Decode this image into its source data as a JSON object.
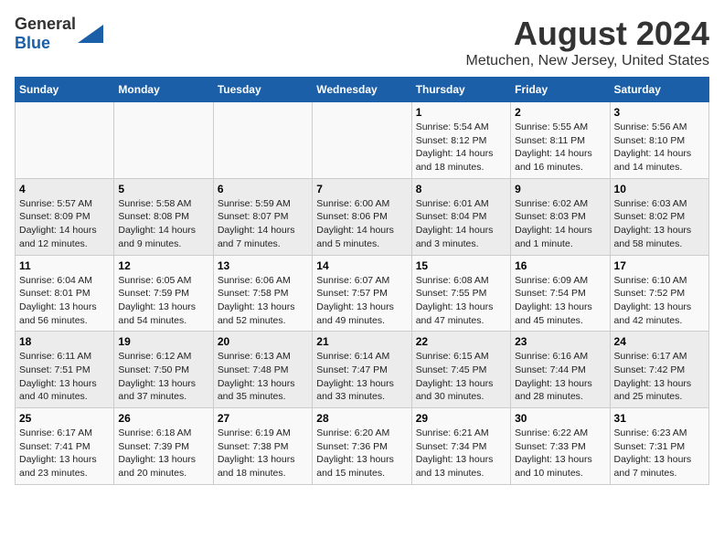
{
  "header": {
    "logo_general": "General",
    "logo_blue": "Blue",
    "month_title": "August 2024",
    "location": "Metuchen, New Jersey, United States"
  },
  "days_of_week": [
    "Sunday",
    "Monday",
    "Tuesday",
    "Wednesday",
    "Thursday",
    "Friday",
    "Saturday"
  ],
  "weeks": [
    [
      {
        "day": "",
        "info": ""
      },
      {
        "day": "",
        "info": ""
      },
      {
        "day": "",
        "info": ""
      },
      {
        "day": "",
        "info": ""
      },
      {
        "day": "1",
        "info": "Sunrise: 5:54 AM\nSunset: 8:12 PM\nDaylight: 14 hours\nand 18 minutes."
      },
      {
        "day": "2",
        "info": "Sunrise: 5:55 AM\nSunset: 8:11 PM\nDaylight: 14 hours\nand 16 minutes."
      },
      {
        "day": "3",
        "info": "Sunrise: 5:56 AM\nSunset: 8:10 PM\nDaylight: 14 hours\nand 14 minutes."
      }
    ],
    [
      {
        "day": "4",
        "info": "Sunrise: 5:57 AM\nSunset: 8:09 PM\nDaylight: 14 hours\nand 12 minutes."
      },
      {
        "day": "5",
        "info": "Sunrise: 5:58 AM\nSunset: 8:08 PM\nDaylight: 14 hours\nand 9 minutes."
      },
      {
        "day": "6",
        "info": "Sunrise: 5:59 AM\nSunset: 8:07 PM\nDaylight: 14 hours\nand 7 minutes."
      },
      {
        "day": "7",
        "info": "Sunrise: 6:00 AM\nSunset: 8:06 PM\nDaylight: 14 hours\nand 5 minutes."
      },
      {
        "day": "8",
        "info": "Sunrise: 6:01 AM\nSunset: 8:04 PM\nDaylight: 14 hours\nand 3 minutes."
      },
      {
        "day": "9",
        "info": "Sunrise: 6:02 AM\nSunset: 8:03 PM\nDaylight: 14 hours\nand 1 minute."
      },
      {
        "day": "10",
        "info": "Sunrise: 6:03 AM\nSunset: 8:02 PM\nDaylight: 13 hours\nand 58 minutes."
      }
    ],
    [
      {
        "day": "11",
        "info": "Sunrise: 6:04 AM\nSunset: 8:01 PM\nDaylight: 13 hours\nand 56 minutes."
      },
      {
        "day": "12",
        "info": "Sunrise: 6:05 AM\nSunset: 7:59 PM\nDaylight: 13 hours\nand 54 minutes."
      },
      {
        "day": "13",
        "info": "Sunrise: 6:06 AM\nSunset: 7:58 PM\nDaylight: 13 hours\nand 52 minutes."
      },
      {
        "day": "14",
        "info": "Sunrise: 6:07 AM\nSunset: 7:57 PM\nDaylight: 13 hours\nand 49 minutes."
      },
      {
        "day": "15",
        "info": "Sunrise: 6:08 AM\nSunset: 7:55 PM\nDaylight: 13 hours\nand 47 minutes."
      },
      {
        "day": "16",
        "info": "Sunrise: 6:09 AM\nSunset: 7:54 PM\nDaylight: 13 hours\nand 45 minutes."
      },
      {
        "day": "17",
        "info": "Sunrise: 6:10 AM\nSunset: 7:52 PM\nDaylight: 13 hours\nand 42 minutes."
      }
    ],
    [
      {
        "day": "18",
        "info": "Sunrise: 6:11 AM\nSunset: 7:51 PM\nDaylight: 13 hours\nand 40 minutes."
      },
      {
        "day": "19",
        "info": "Sunrise: 6:12 AM\nSunset: 7:50 PM\nDaylight: 13 hours\nand 37 minutes."
      },
      {
        "day": "20",
        "info": "Sunrise: 6:13 AM\nSunset: 7:48 PM\nDaylight: 13 hours\nand 35 minutes."
      },
      {
        "day": "21",
        "info": "Sunrise: 6:14 AM\nSunset: 7:47 PM\nDaylight: 13 hours\nand 33 minutes."
      },
      {
        "day": "22",
        "info": "Sunrise: 6:15 AM\nSunset: 7:45 PM\nDaylight: 13 hours\nand 30 minutes."
      },
      {
        "day": "23",
        "info": "Sunrise: 6:16 AM\nSunset: 7:44 PM\nDaylight: 13 hours\nand 28 minutes."
      },
      {
        "day": "24",
        "info": "Sunrise: 6:17 AM\nSunset: 7:42 PM\nDaylight: 13 hours\nand 25 minutes."
      }
    ],
    [
      {
        "day": "25",
        "info": "Sunrise: 6:17 AM\nSunset: 7:41 PM\nDaylight: 13 hours\nand 23 minutes."
      },
      {
        "day": "26",
        "info": "Sunrise: 6:18 AM\nSunset: 7:39 PM\nDaylight: 13 hours\nand 20 minutes."
      },
      {
        "day": "27",
        "info": "Sunrise: 6:19 AM\nSunset: 7:38 PM\nDaylight: 13 hours\nand 18 minutes."
      },
      {
        "day": "28",
        "info": "Sunrise: 6:20 AM\nSunset: 7:36 PM\nDaylight: 13 hours\nand 15 minutes."
      },
      {
        "day": "29",
        "info": "Sunrise: 6:21 AM\nSunset: 7:34 PM\nDaylight: 13 hours\nand 13 minutes."
      },
      {
        "day": "30",
        "info": "Sunrise: 6:22 AM\nSunset: 7:33 PM\nDaylight: 13 hours\nand 10 minutes."
      },
      {
        "day": "31",
        "info": "Sunrise: 6:23 AM\nSunset: 7:31 PM\nDaylight: 13 hours\nand 7 minutes."
      }
    ]
  ]
}
